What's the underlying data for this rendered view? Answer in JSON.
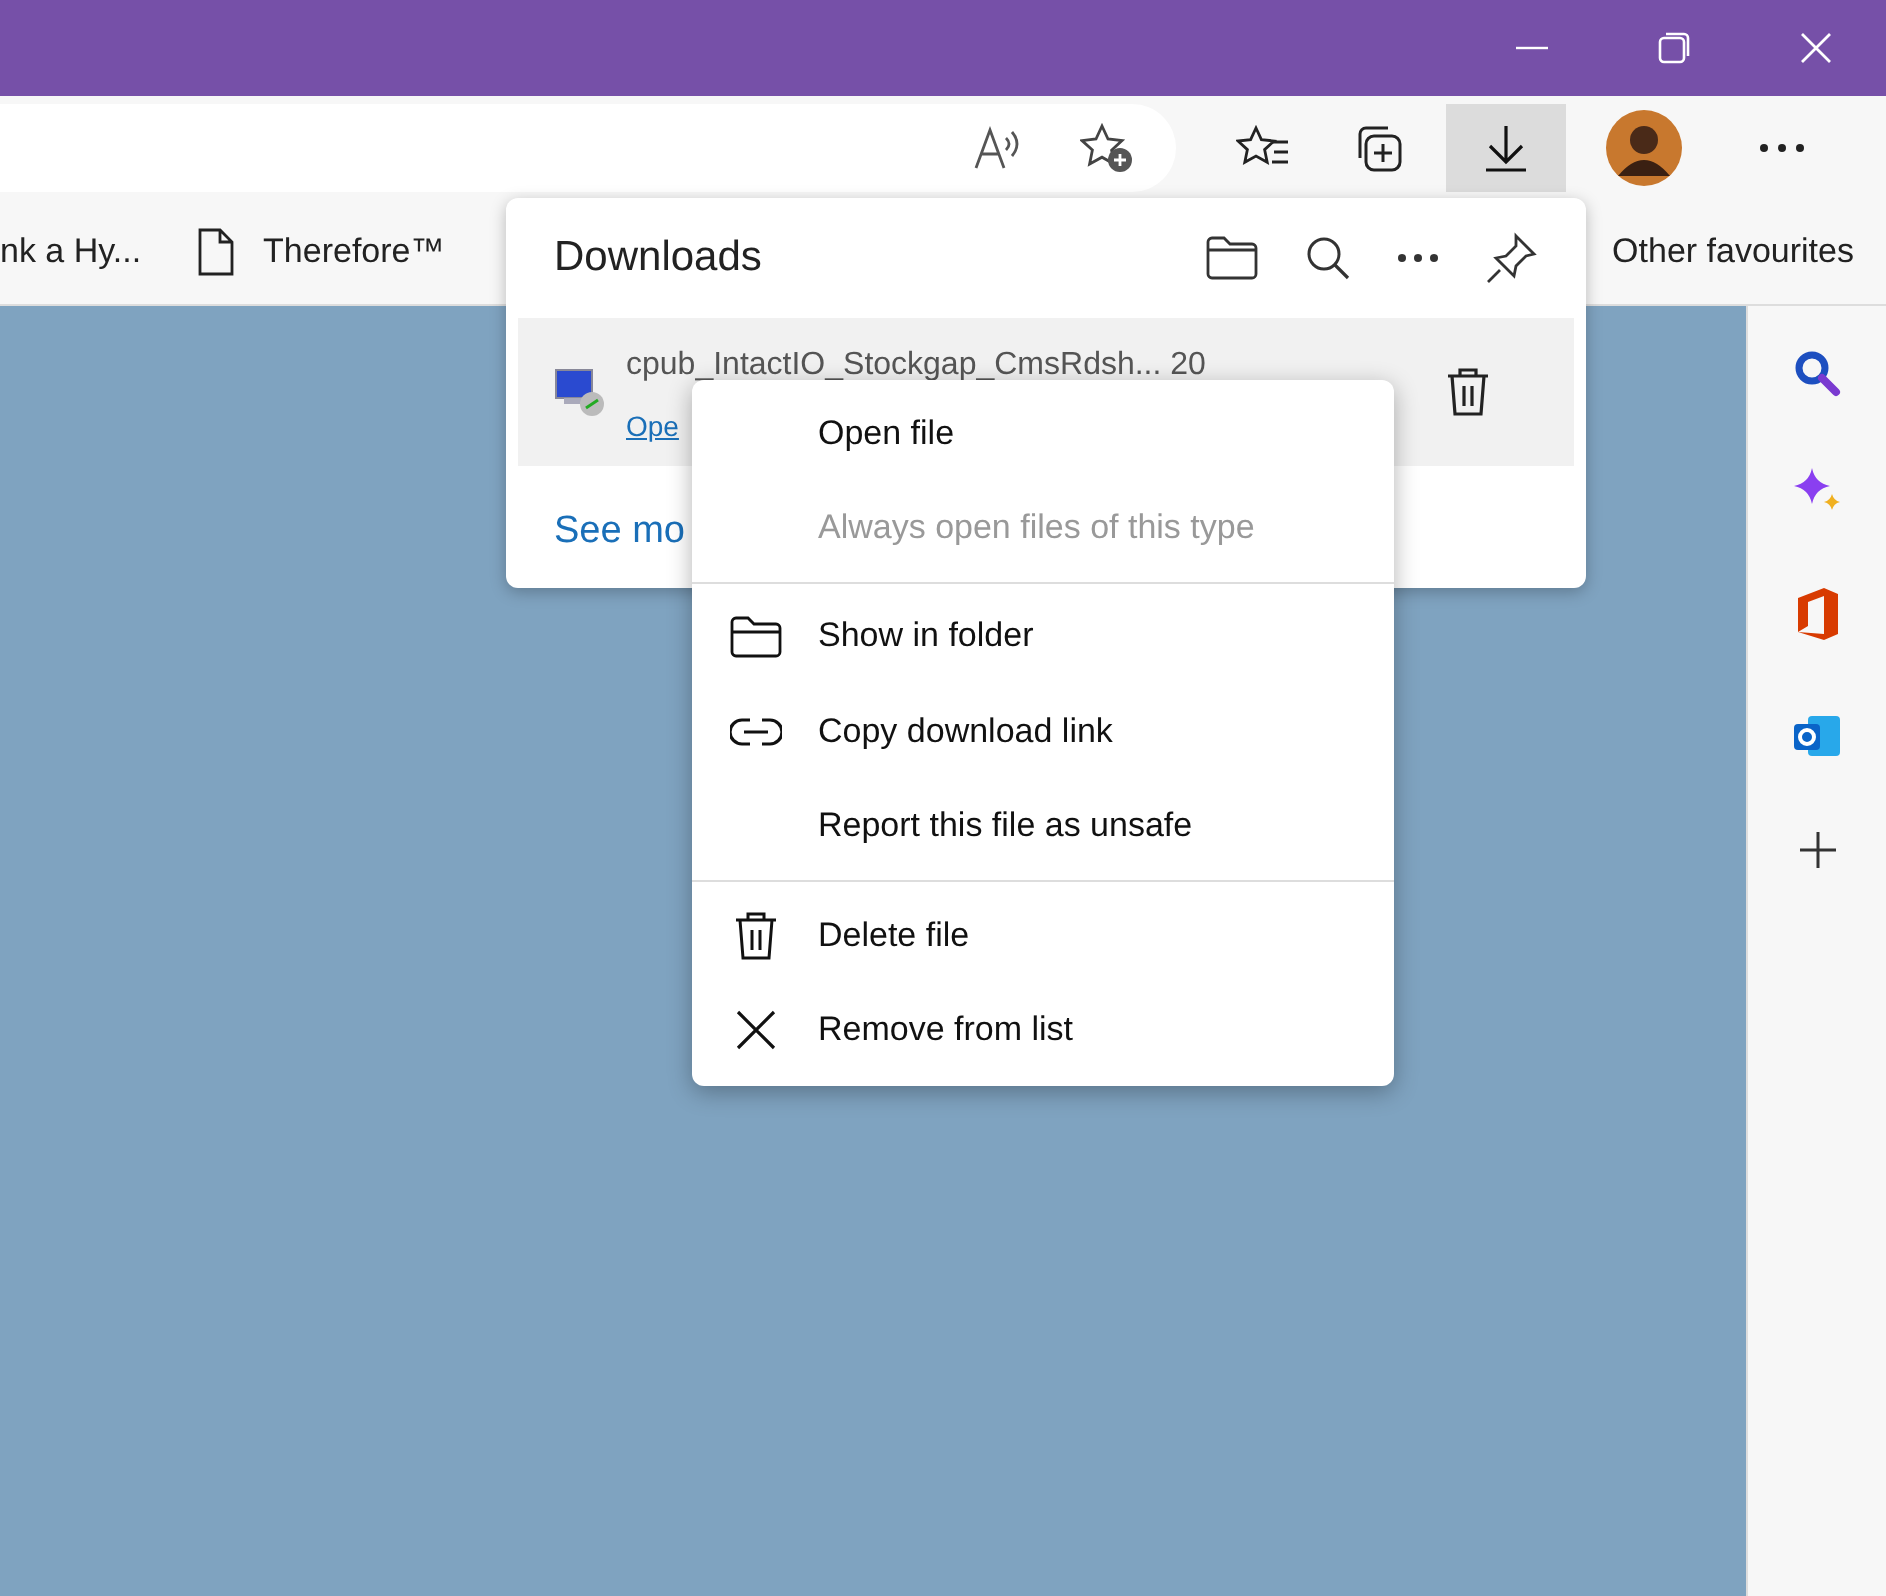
{
  "favorites_bar": {
    "items": [
      {
        "label": "nk a Hy...",
        "kind": "plain"
      },
      {
        "label": "Therefore™",
        "kind": "page"
      }
    ],
    "other": "Other favourites"
  },
  "downloads": {
    "title": "Downloads",
    "item": {
      "name": "cpub_IntactIO_Stockgap_CmsRdsh... 20",
      "link": "Ope"
    },
    "see_more": "See mo"
  },
  "context_menu": {
    "groups": [
      [
        {
          "label": "Open file",
          "disabled": false
        },
        {
          "label": "Always open files of this type",
          "disabled": true
        }
      ],
      [
        {
          "label": "Show in folder",
          "disabled": false
        },
        {
          "label": "Copy download link",
          "disabled": false
        },
        {
          "label": "Report this file as unsafe",
          "disabled": false
        }
      ],
      [
        {
          "label": "Delete file",
          "disabled": false
        },
        {
          "label": "Remove from list",
          "disabled": false
        }
      ]
    ]
  }
}
